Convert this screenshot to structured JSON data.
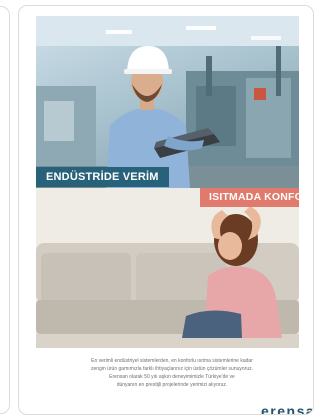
{
  "promo": {
    "banner_industry": "ENDÜSTRİDE VERİM",
    "banner_heating": "ISITMADA KONFOR",
    "description_lines": [
      "En verimli endüstriyel sistemlerden, en konforlu ısıtma sistemlerine kadar",
      "zengin ürün gamımızla farklı ihtiyaçlarınız için üstün çözümler sunuyoruz.",
      "Erensan olarak 50 yılı aşkın deneyimimizle Türkiye'de ve",
      "dünyanın en prestijli projelerinde yerimizi alıyoruz."
    ],
    "brand": "erensan"
  },
  "colors": {
    "industry_banner": "#27627a",
    "heating_banner": "#e07a6c",
    "brand": "#25526b"
  }
}
